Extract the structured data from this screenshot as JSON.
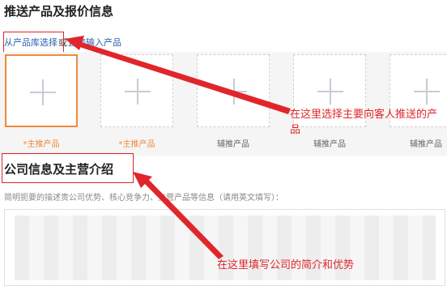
{
  "sections": {
    "products_title": "推送产品及报价信息",
    "company_title": "公司信息及主营介绍"
  },
  "product_links": {
    "select_from_library": "从产品库选择",
    "or": "或",
    "manual_input": "直接输入产品"
  },
  "product_slots": [
    {
      "label": "*主推产品",
      "type": "main",
      "active": true
    },
    {
      "label": "*主推产品",
      "type": "main",
      "active": false
    },
    {
      "label": "辅推产品",
      "type": "sub",
      "active": false
    },
    {
      "label": "辅推产品",
      "type": "sub",
      "active": false
    },
    {
      "label": "辅推产品",
      "type": "sub",
      "active": false
    }
  ],
  "company": {
    "hint": "简明扼要的描述贵公司优势、核心竞争力、主营产品等信息（请用英文填写）："
  },
  "annotations": {
    "products_note": "在这里选择主要向客人推送的产品",
    "company_note": "在这里填写公司的简介和优势"
  },
  "colors": {
    "accent_orange": "#f08a3c",
    "link_blue": "#2a5db0",
    "annotation_red": "#e0262b"
  }
}
